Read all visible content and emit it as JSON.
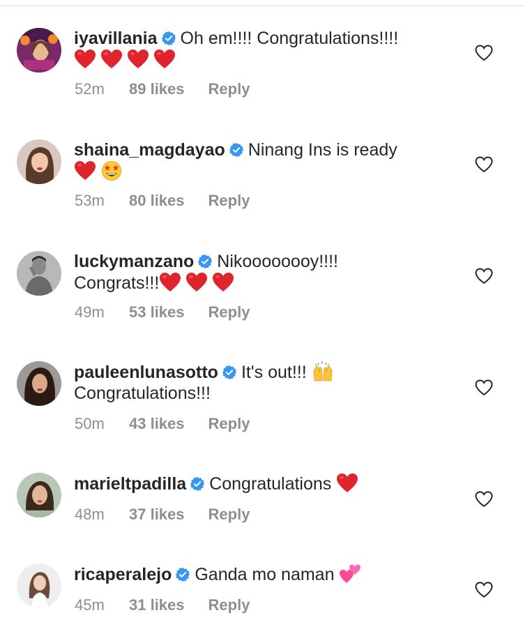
{
  "comments": [
    {
      "username": "iyavillania",
      "text": "Oh em!!!! Congratulations!!!!",
      "emojis": [
        "red-heart",
        "red-heart",
        "red-heart",
        "red-heart"
      ],
      "time": "52m",
      "likes": "89 likes",
      "reply": "Reply",
      "avatar": "avatar-iyavillania"
    },
    {
      "username": "shaina_magdayao",
      "text": "Ninang Ins is ready",
      "emojis": [
        "red-heart",
        "star-struck"
      ],
      "time": "53m",
      "likes": "80 likes",
      "reply": "Reply",
      "avatar": "avatar-shaina"
    },
    {
      "username": "luckymanzano",
      "text": "Nikoooooooy!!!!",
      "text2": "Congrats!!!",
      "emojis": [
        "red-heart",
        "red-heart",
        "red-heart"
      ],
      "time": "49m",
      "likes": "53 likes",
      "reply": "Reply",
      "avatar": "avatar-lucky"
    },
    {
      "username": "pauleenlunasotto",
      "text": "It's out!!!",
      "text2": "Congratulations!!!",
      "emojis": [
        "raising-hands"
      ],
      "time": "50m",
      "likes": "43 likes",
      "reply": "Reply",
      "avatar": "avatar-pauleen"
    },
    {
      "username": "marieltpadilla",
      "text": "Congratulations",
      "emojis": [
        "red-heart"
      ],
      "time": "48m",
      "likes": "37 likes",
      "reply": "Reply",
      "avatar": "avatar-mariel"
    },
    {
      "username": "ricaperalejo",
      "text": "Ganda mo naman",
      "emojis": [
        "two-hearts"
      ],
      "time": "45m",
      "likes": "31 likes",
      "reply": "Reply",
      "avatar": "avatar-rica"
    }
  ],
  "icons": {
    "verified": "verified-badge-icon",
    "like": "heart-outline-icon"
  },
  "colors": {
    "verified": "#3897f0",
    "meta": "#8e8e8e",
    "text": "#262626",
    "heart": "#e0242e"
  }
}
